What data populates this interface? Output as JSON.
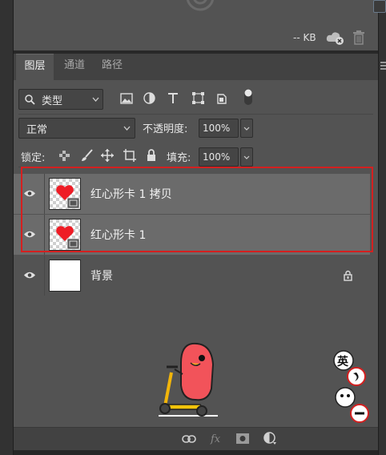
{
  "library": {
    "size_label": "-- KB"
  },
  "tabs": [
    {
      "label": "图层",
      "active": true
    },
    {
      "label": "通道",
      "active": false
    },
    {
      "label": "路径",
      "active": false
    }
  ],
  "filter": {
    "label": "类型",
    "filter_icons": [
      "image-filter-icon",
      "adjustment-filter-icon",
      "type-filter-icon",
      "shape-filter-icon",
      "smart-object-filter-icon",
      "filter-toggle-icon"
    ]
  },
  "blend": {
    "mode": "正常",
    "opacity_label": "不透明度:",
    "opacity": "100%"
  },
  "lock": {
    "label": "锁定:",
    "fill_label": "填充:",
    "fill": "100%"
  },
  "layers": [
    {
      "name": "红心形卡 1 拷贝",
      "selected": true,
      "thumb": "heart-smart-object"
    },
    {
      "name": "红心形卡 1",
      "selected": true,
      "thumb": "heart-smart-object"
    },
    {
      "name": "背景",
      "selected": false,
      "thumb": "white",
      "locked": true
    }
  ],
  "sticker_text": "英",
  "colors": {
    "panel": "#535353",
    "selected_row": "#6b6b6b",
    "highlight_box": "#d42020",
    "heart": "#ee1c25"
  }
}
